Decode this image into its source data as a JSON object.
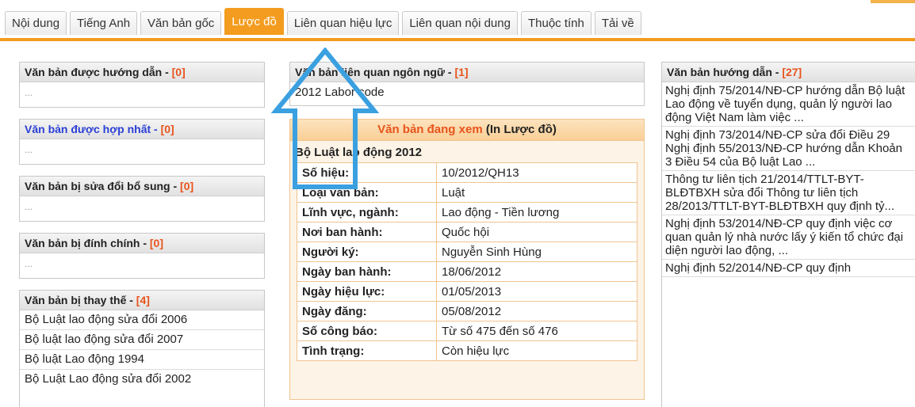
{
  "tabs": [
    {
      "label": "Nội dung",
      "active": false
    },
    {
      "label": "Tiếng Anh",
      "active": false
    },
    {
      "label": "Văn bản gốc",
      "active": false
    },
    {
      "label": "Lược đồ",
      "active": true
    },
    {
      "label": "Liên quan hiệu lực",
      "active": false
    },
    {
      "label": "Liên quan nội dung",
      "active": false
    },
    {
      "label": "Thuộc tính",
      "active": false
    },
    {
      "label": "Tải về",
      "active": false
    }
  ],
  "left": {
    "huong_dan": {
      "title": "Văn bản được hướng dẫn - ",
      "count": "[0]",
      "empty": "..."
    },
    "hop_nhat": {
      "title": "Văn bản được hợp nhất - ",
      "count": "[0]",
      "empty": "..."
    },
    "sua_doi": {
      "title": "Văn bản bị sửa đổi bổ sung - ",
      "count": "[0]",
      "empty": "..."
    },
    "dinh_chinh": {
      "title": "Văn bản bị đính chính - ",
      "count": "[0]",
      "empty": "..."
    },
    "thay_the": {
      "title": "Văn bản bị thay thế - ",
      "count": "[4]",
      "items": [
        "Bộ Luật lao động sửa đổi 2006",
        "Bộ luật lao động sửa đổi 2007",
        "Bộ luật Lao động 1994",
        "Bộ Luật Lao động sửa đổi 2002"
      ]
    }
  },
  "middle": {
    "ngon_ngu": {
      "title": "Văn bản liên quan ngôn ngữ - ",
      "count": "[1]",
      "item": "2012 Labor code"
    },
    "current": {
      "head_red": "Văn bản đang xem",
      "head_link": " (In Lược đồ)",
      "title": "Bộ Luật lao động 2012",
      "rows": [
        {
          "k": "Số hiệu:",
          "v": "10/2012/QH13"
        },
        {
          "k": "Loại văn bản:",
          "v": "Luật"
        },
        {
          "k": "Lĩnh vực, ngành:",
          "v": "Lao động - Tiền lương"
        },
        {
          "k": "Nơi ban hành:",
          "v": "Quốc hội"
        },
        {
          "k": "Người ký:",
          "v": "Nguyễn Sinh Hùng"
        },
        {
          "k": "Ngày ban hành:",
          "v": "18/06/2012"
        },
        {
          "k": "Ngày hiệu lực:",
          "v": "01/05/2013"
        },
        {
          "k": "Ngày đăng:",
          "v": "05/08/2012"
        },
        {
          "k": "Số công báo:",
          "v": "Từ số 475 đến số 476"
        },
        {
          "k": "Tình trạng:",
          "v": "Còn hiệu lực"
        }
      ]
    }
  },
  "right": {
    "title": "Văn bản hướng dẫn - ",
    "count": "[27]",
    "items": [
      "Nghị định 75/2014/NĐ-CP hướng dẫn Bộ luật Lao động về tuyển dụng, quản lý người lao động Việt Nam làm việc ...",
      "Nghị định 73/2014/NĐ-CP sửa đổi Điều 29 Nghị định 55/2013/NĐ-CP hướng dẫn Khoản 3 Điều 54 của Bộ luật Lao ...",
      "Thông tư liên tịch 21/2014/TTLT-BYT-BLĐTBXH sửa đổi Thông tư liên tịch 28/2013/TTLT-BYT-BLĐTBXH quy định tỷ...",
      "Nghị định 53/2014/NĐ-CP quy định việc cơ quan quản lý nhà nước lấy ý kiến tổ chức đại diện người lao động, ...",
      "Nghị định 52/2014/NĐ-CP quy định"
    ]
  },
  "colors": {
    "accent": "#f39c1f",
    "count": "#e8541c",
    "link": "#2a3fd6",
    "arrow": "#3aa0e0"
  },
  "icons": {
    "annotation": "up-arrow-icon"
  }
}
